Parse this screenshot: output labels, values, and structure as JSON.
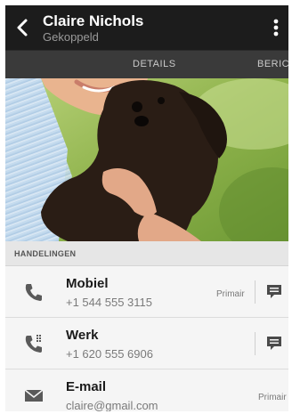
{
  "header": {
    "title": "Claire Nichols",
    "subtitle": "Gekoppeld",
    "back_icon": "back-arrow-icon",
    "menu_icon": "overflow-menu-icon"
  },
  "tabs": [
    {
      "label": "DETAILS",
      "active": true
    },
    {
      "label": "BERICH"
    }
  ],
  "photo": {
    "description_icon": "contact-photo"
  },
  "section": {
    "label": "HANDELINGEN"
  },
  "rows": [
    {
      "label": "Mobiel",
      "value": "+1 544 555 3115",
      "tag": "Primair",
      "icon": "phone-icon",
      "action_icon": "message-icon"
    },
    {
      "label": "Werk",
      "value": "+1 620 555 6906",
      "tag": "",
      "icon": "work-phone-icon",
      "action_icon": "message-icon"
    },
    {
      "label": "E-mail",
      "value": "claire@gmail.com",
      "tag": "Primair",
      "icon": "email-icon"
    }
  ],
  "colors": {
    "header_bg": "#1c1c1c",
    "tabs_bg": "#3a3a3a",
    "section_bg": "#e6e6e6",
    "row_bg": "#f5f5f5"
  }
}
